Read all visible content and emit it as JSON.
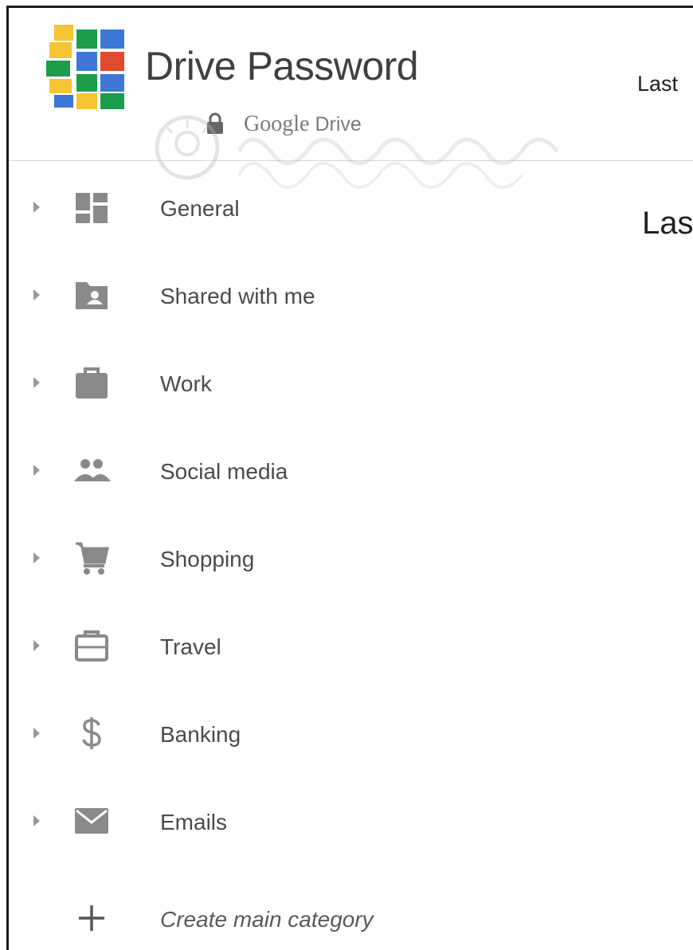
{
  "header": {
    "app_title": "Drive Password",
    "subtitle_brand": "Google",
    "subtitle_product": "Drive",
    "right_label": "Last"
  },
  "main": {
    "heading": "Las"
  },
  "sidebar": {
    "items": [
      {
        "label": "General",
        "icon": "dashboard-icon"
      },
      {
        "label": "Shared with me",
        "icon": "shared-folder-icon"
      },
      {
        "label": "Work",
        "icon": "briefcase-icon"
      },
      {
        "label": "Social media",
        "icon": "people-icon"
      },
      {
        "label": "Shopping",
        "icon": "shopping-cart-icon"
      },
      {
        "label": "Travel",
        "icon": "luggage-icon"
      },
      {
        "label": "Banking",
        "icon": "dollar-icon"
      },
      {
        "label": "Emails",
        "icon": "envelope-icon"
      }
    ],
    "create_label": "Create main category"
  },
  "colors": {
    "logo_yellow": "#f5c533",
    "logo_green": "#1b9d4c",
    "logo_blue": "#3e78d6",
    "logo_red": "#e04a2d",
    "icon_gray": "#8a8a8a",
    "text": "#4a4a4a"
  }
}
